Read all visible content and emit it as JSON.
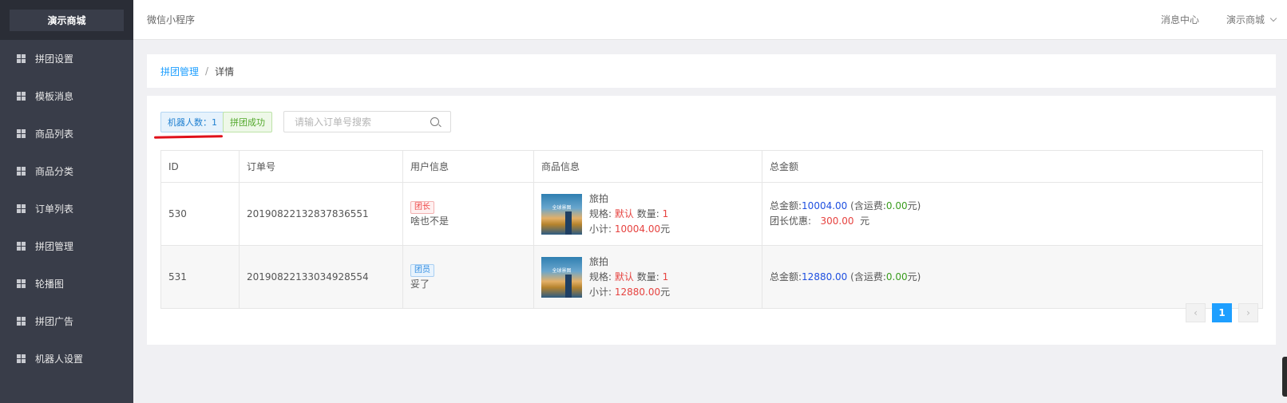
{
  "sidebar": {
    "brand": "演示商城",
    "items": [
      {
        "label": "拼团设置"
      },
      {
        "label": "模板消息"
      },
      {
        "label": "商品列表"
      },
      {
        "label": "商品分类"
      },
      {
        "label": "订单列表"
      },
      {
        "label": "拼团管理"
      },
      {
        "label": "轮播图"
      },
      {
        "label": "拼团广告"
      },
      {
        "label": "机器人设置"
      }
    ]
  },
  "header": {
    "title": "微信小程序",
    "message_center": "消息中心",
    "account": "演示商城"
  },
  "breadcrumb": {
    "parent": "拼团管理",
    "separator": "/",
    "current": "详情"
  },
  "toolbar": {
    "robot_count_tag": "机器人数：1",
    "status_tag": "拼团成功",
    "search_placeholder": "请输入订单号搜索"
  },
  "table": {
    "headers": [
      "ID",
      "订单号",
      "用户信息",
      "商品信息",
      "总金额"
    ],
    "rows": [
      {
        "id": "530",
        "order_no": "20190822132837836551",
        "role": "团长",
        "user_name": "啥也不是",
        "thumb_text": "全球景图",
        "product_name": "旅拍",
        "spec_label": "规格:",
        "spec_value": "默认",
        "qty_label": "数量:",
        "qty_value": "1",
        "subtotal_label": "小计:",
        "subtotal_value": "10004.00",
        "yuan": "元",
        "total_label": "总金额:",
        "total_value": "10004.00",
        "shipping_label": "(含运费:",
        "shipping_value": "0.00",
        "shipping_suffix": "元)",
        "discount_label": "团长优惠:",
        "discount_value": "300.00",
        "discount_suffix": "元"
      },
      {
        "id": "531",
        "order_no": "20190822133034928554",
        "role": "团员",
        "user_name": "妥了",
        "thumb_text": "全球景图",
        "product_name": "旅拍",
        "spec_label": "规格:",
        "spec_value": "默认",
        "qty_label": "数量:",
        "qty_value": "1",
        "subtotal_label": "小计:",
        "subtotal_value": "12880.00",
        "yuan": "元",
        "total_label": "总金额:",
        "total_value": "12880.00",
        "shipping_label": "(含运费:",
        "shipping_value": "0.00",
        "shipping_suffix": "元)"
      }
    ]
  },
  "pagination": {
    "prev": "‹",
    "current": "1",
    "next": "›"
  },
  "colors": {
    "sidebar_bg": "#393d49",
    "accent": "#1e9fff",
    "price_red": "#e64340",
    "total_blue": "#1e4fe0"
  }
}
